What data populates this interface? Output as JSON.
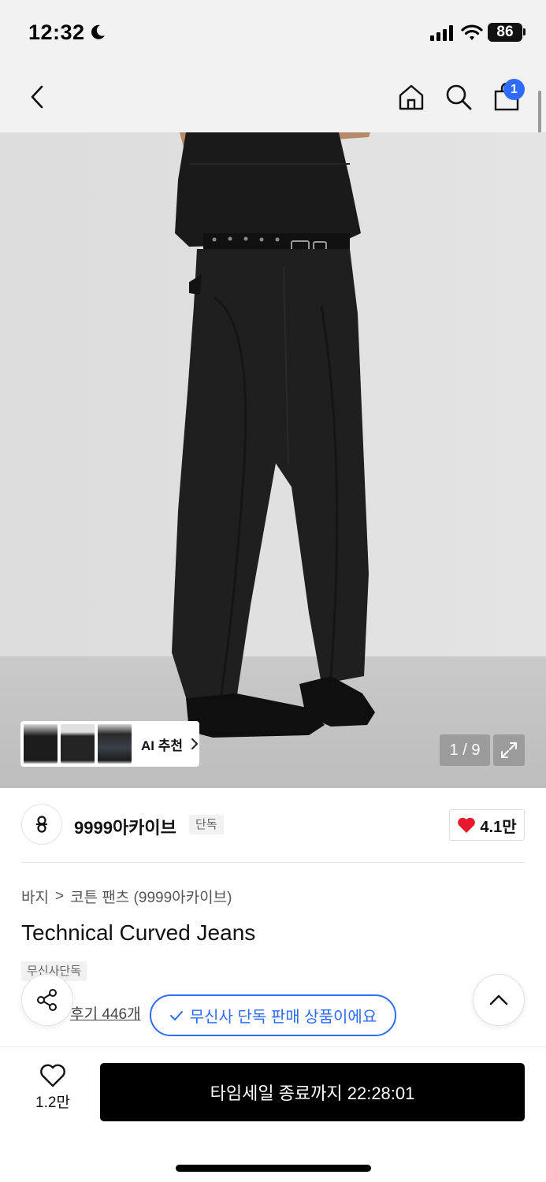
{
  "status_bar": {
    "time": "12:32",
    "battery": "86"
  },
  "nav": {
    "cart_badge": "1"
  },
  "image": {
    "ai_label": "AI 추천",
    "page_counter": "1 / 9"
  },
  "brand": {
    "name": "9999아카이브",
    "badge": "단독",
    "likes": "4.1만"
  },
  "breadcrumb": {
    "category": "바지",
    "separator": ">",
    "subcategory": "코튼 팬츠 (9999아카이브)"
  },
  "product": {
    "title": "Technical Curved Jeans",
    "tag": "무신사단독",
    "reviews": "후기 446개"
  },
  "toast": {
    "text": "무신사 단독 판매 상품이에요"
  },
  "bottom": {
    "wish_count": "1.2만",
    "buy_label": "타임세일 종료까지 22:28:01"
  },
  "colors": {
    "accent": "#2f6bff",
    "heart": "#e8192c",
    "button": "#000000"
  }
}
